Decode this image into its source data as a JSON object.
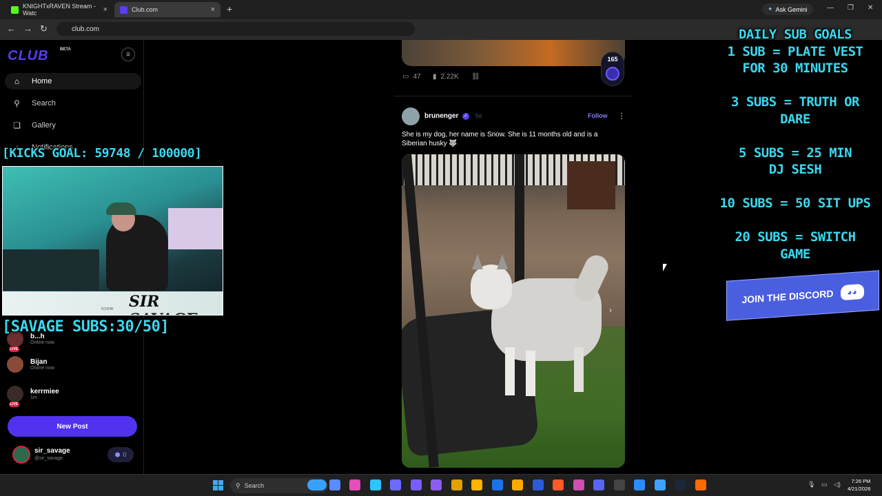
{
  "browser": {
    "tabs": [
      {
        "label": "KNIGHTxRAVEN Stream - Watc",
        "favicon_color": "#53fc18"
      },
      {
        "label": "Club.com",
        "favicon_color": "#5a3cf2"
      }
    ],
    "close_glyph": "×",
    "new_tab_glyph": "+",
    "gemini_label": "Ask Gemini",
    "url": "club.com"
  },
  "sidebar": {
    "logo": "CLUB",
    "beta": "BETA",
    "nav": [
      {
        "label": "Home",
        "icon": "home-icon"
      },
      {
        "label": "Search",
        "icon": "search-icon"
      },
      {
        "label": "Gallery",
        "icon": "gallery-icon"
      },
      {
        "label": "Notifications",
        "icon": "bell-icon"
      }
    ],
    "live_list": [
      {
        "name": "b...h",
        "status": "Online now",
        "live": true
      },
      {
        "name": "Bijan",
        "status": "Online now",
        "live": false
      },
      {
        "name": "kerrmiee",
        "status": "1m",
        "live": true
      }
    ],
    "live_badge": "LIVE",
    "new_post": "New Post",
    "me": {
      "name": "sir_savage",
      "handle": "@sir_savage",
      "points": "0"
    }
  },
  "overlay": {
    "kicks_goal": "[KICKS GOAL: 59748 / 100000]",
    "savage_subs": "[SAVAGE SUBS:30/50]",
    "cam_name": "SIR SAVAGE",
    "cam_tag": "FOXHR",
    "goals": [
      "DAILY SUB GOALS",
      "1 SUB = PLATE VEST",
      "FOR 30 MINUTES",
      "",
      "3 SUBS = TRUTH OR",
      "DARE",
      "",
      "5 SUBS = 25 MIN",
      "DJ SESH",
      "",
      "10 SUBS = 50 SIT UPS",
      "",
      "20 SUBS = SWITCH",
      "GAME"
    ],
    "discord": "JOIN THE DISCORD"
  },
  "feed": {
    "prev_post": {
      "comments": "47",
      "views": "2.22K",
      "rank": "165"
    },
    "post": {
      "user": "brunenger",
      "time": "5d",
      "follow": "Follow",
      "text": "She is my dog, her name is Snow. She is 11 months old and is a Siberian husky 🐺"
    }
  },
  "taskbar": {
    "search": "Search",
    "time": "7:26 PM",
    "date": "4/21/2026",
    "apps": [
      "#3aa0ff",
      "#5b8cff",
      "#e34fb8",
      "#2ec4ff",
      "#6b6bff",
      "#7b5cff",
      "#8a5cf0",
      "#e0a000",
      "#ffb400",
      "#1a73e8",
      "#ffaa00",
      "#2d5bd8",
      "#ff5a2a",
      "#d04fb0",
      "#5865f2",
      "#444444",
      "#2b8cff",
      "#3fa0ff",
      "#1b2838",
      "#ff6a00"
    ]
  }
}
